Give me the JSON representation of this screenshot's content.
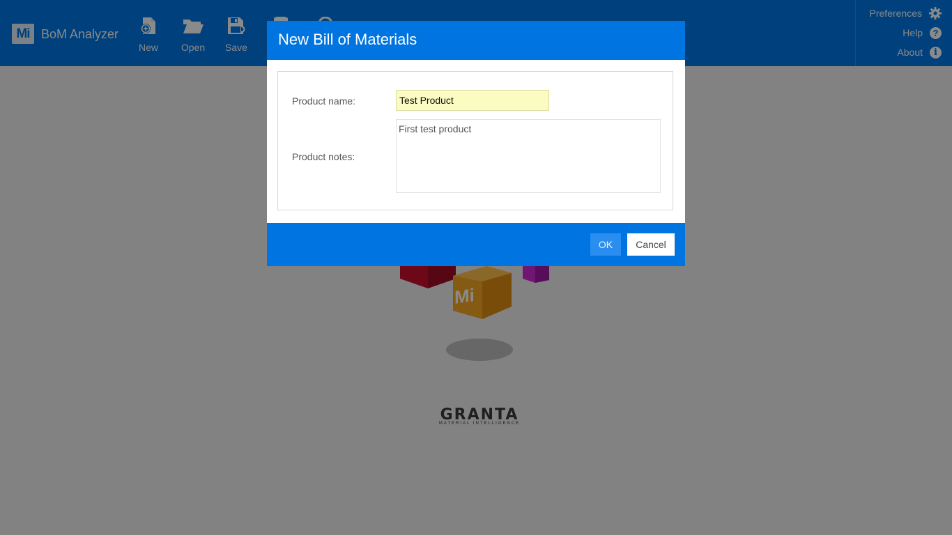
{
  "app": {
    "logo_text": "Mi",
    "title": "BoM Analyzer"
  },
  "toolbar": {
    "items": [
      {
        "label": "New",
        "icon": "new-document-icon"
      },
      {
        "label": "Open",
        "icon": "folder-open-icon"
      },
      {
        "label": "Save",
        "icon": "save-icon"
      }
    ]
  },
  "right_menu": {
    "items": [
      {
        "label": "Preferences",
        "icon": "gear-icon"
      },
      {
        "label": "Help",
        "icon": "help-icon"
      },
      {
        "label": "About",
        "icon": "info-icon"
      }
    ]
  },
  "splash": {
    "cube_text": "Mi",
    "brand": "GRANTA",
    "brand_tagline": "MATERIAL INTELLIGENCE"
  },
  "dialog": {
    "title": "New Bill of Materials",
    "product_name_label": "Product name:",
    "product_name_value": "Test Product",
    "product_notes_label": "Product notes:",
    "product_notes_value": "First test product",
    "ok_label": "OK",
    "cancel_label": "Cancel"
  },
  "colors": {
    "header_blue": "#0077e6",
    "dialog_blue": "#0074e0",
    "input_highlight": "#fafcc2"
  }
}
